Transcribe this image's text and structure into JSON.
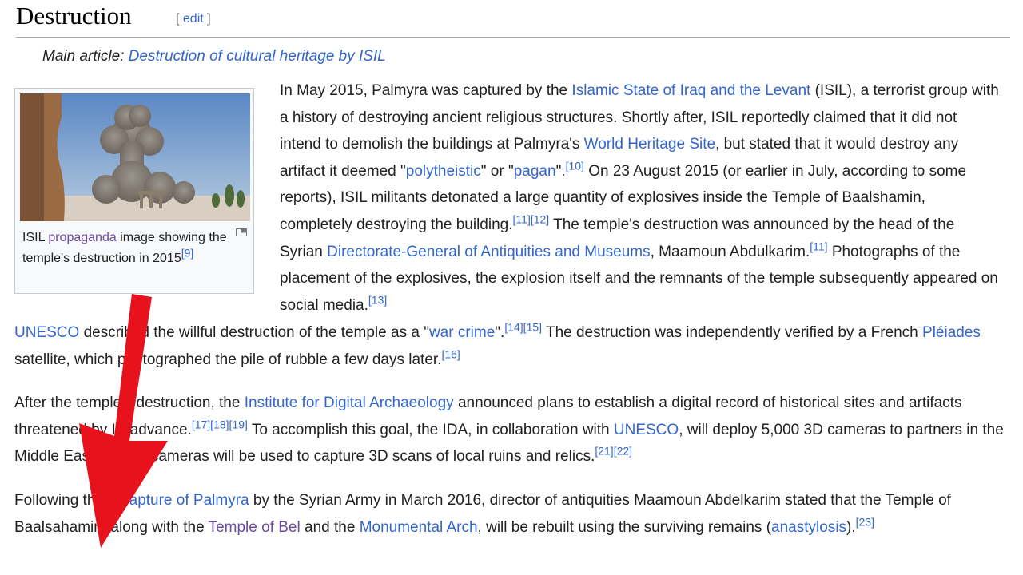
{
  "heading": {
    "title": "Destruction",
    "edit_open": "[",
    "edit_label": "edit",
    "edit_close": "]"
  },
  "hatnote": {
    "prefix": "Main article:",
    "link": "Destruction of cultural heritage by ISIL"
  },
  "thumb": {
    "caption_1": "ISIL",
    "caption_link": "propaganda",
    "caption_2": "image showing the temple's destruction in 2015",
    "caption_ref": "[9]"
  },
  "p1": {
    "t1": "In May 2015, Palmyra was captured by the",
    "l1": "Islamic State of Iraq and the Levant",
    "t2": "(ISIL), a terrorist group with a history of destroying ancient religious structures. Shortly after, ISIL reportedly claimed that it did not intend to demolish the buildings at Palmyra's",
    "l2": "World Heritage Site",
    "t3": ", but stated that it would destroy any artifact it deemed \"",
    "l3": "polytheistic",
    "t4": "\" or \"",
    "l4": "pagan",
    "t5": "\".",
    "r1": "[10]",
    "t6": "On 23 August 2015 (or earlier in July, according to some reports), ISIL militants detonated a large quantity of explosives inside the Temple of Baalshamin, completely destroying the building.",
    "r2": "[11][12]",
    "t7": "The temple's destruction was announced by the head of the Syrian",
    "l5": "Directorate-General of Antiquities and Museums",
    "t8": ", Maamoun Abdulkarim.",
    "r3": "[11]",
    "t9": "Photographs of the placement of the explosives, the explosion itself and the remnants of the temple subsequently appeared on social media.",
    "r4": "[13]"
  },
  "p1b": {
    "l1": "UNESCO",
    "t1": "described the willful destruction of the temple as a \"",
    "l2": "war crime",
    "t2": "\".",
    "r1": "[14][15]",
    "t3": "The destruction was independently verified by a French",
    "l3": "Pléiades",
    "t4": "satellite, which photographed the pile of rubble a few days later.",
    "r2": "[16]"
  },
  "p2": {
    "t1": "After the temple's destruction, the",
    "l1": "Institute for Digital Archaeology",
    "t2": "announced plans to establish a digital record of historical sites and artifacts threatened by IS advance.",
    "r1": "[17][18][19]",
    "t3": "To accomplish this goal, the IDA, in collaboration with",
    "l2": "UNESCO",
    "t4": ", will deploy 5,000 3D cameras to partners in the Middle East.",
    "r2": "[20]",
    "t5": "The cameras will be used to capture 3D scans of local ruins and relics.",
    "r3": "[21][22]"
  },
  "p3": {
    "t1": "Following the",
    "l1": "recapture of Palmyra",
    "t2": "by the Syrian Army in March 2016, director of antiquities Maamoun Abdelkarim stated that the Temple of Baalsahamin, along with the",
    "l2": "Temple of Bel",
    "t3": "and the",
    "l3": "Monumental Arch",
    "t4": ", will be rebuilt using the surviving remains (",
    "l4": "anastylosis",
    "t5": ").",
    "r1": "[23]"
  },
  "colors": {
    "link": "#3366cc",
    "visited": "#6b4ba1",
    "arrow": "#e8121c"
  }
}
